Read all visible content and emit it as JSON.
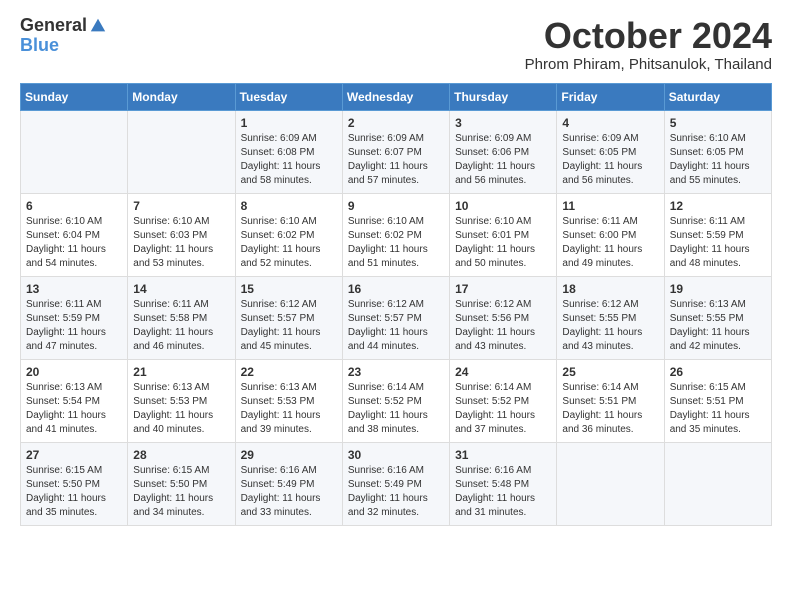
{
  "logo": {
    "general": "General",
    "blue": "Blue"
  },
  "title": "October 2024",
  "location": "Phrom Phiram, Phitsanulok, Thailand",
  "days_of_week": [
    "Sunday",
    "Monday",
    "Tuesday",
    "Wednesday",
    "Thursday",
    "Friday",
    "Saturday"
  ],
  "weeks": [
    [
      {
        "day": "",
        "info": ""
      },
      {
        "day": "",
        "info": ""
      },
      {
        "day": "1",
        "info": "Sunrise: 6:09 AM\nSunset: 6:08 PM\nDaylight: 11 hours and 58 minutes."
      },
      {
        "day": "2",
        "info": "Sunrise: 6:09 AM\nSunset: 6:07 PM\nDaylight: 11 hours and 57 minutes."
      },
      {
        "day": "3",
        "info": "Sunrise: 6:09 AM\nSunset: 6:06 PM\nDaylight: 11 hours and 56 minutes."
      },
      {
        "day": "4",
        "info": "Sunrise: 6:09 AM\nSunset: 6:05 PM\nDaylight: 11 hours and 56 minutes."
      },
      {
        "day": "5",
        "info": "Sunrise: 6:10 AM\nSunset: 6:05 PM\nDaylight: 11 hours and 55 minutes."
      }
    ],
    [
      {
        "day": "6",
        "info": "Sunrise: 6:10 AM\nSunset: 6:04 PM\nDaylight: 11 hours and 54 minutes."
      },
      {
        "day": "7",
        "info": "Sunrise: 6:10 AM\nSunset: 6:03 PM\nDaylight: 11 hours and 53 minutes."
      },
      {
        "day": "8",
        "info": "Sunrise: 6:10 AM\nSunset: 6:02 PM\nDaylight: 11 hours and 52 minutes."
      },
      {
        "day": "9",
        "info": "Sunrise: 6:10 AM\nSunset: 6:02 PM\nDaylight: 11 hours and 51 minutes."
      },
      {
        "day": "10",
        "info": "Sunrise: 6:10 AM\nSunset: 6:01 PM\nDaylight: 11 hours and 50 minutes."
      },
      {
        "day": "11",
        "info": "Sunrise: 6:11 AM\nSunset: 6:00 PM\nDaylight: 11 hours and 49 minutes."
      },
      {
        "day": "12",
        "info": "Sunrise: 6:11 AM\nSunset: 5:59 PM\nDaylight: 11 hours and 48 minutes."
      }
    ],
    [
      {
        "day": "13",
        "info": "Sunrise: 6:11 AM\nSunset: 5:59 PM\nDaylight: 11 hours and 47 minutes."
      },
      {
        "day": "14",
        "info": "Sunrise: 6:11 AM\nSunset: 5:58 PM\nDaylight: 11 hours and 46 minutes."
      },
      {
        "day": "15",
        "info": "Sunrise: 6:12 AM\nSunset: 5:57 PM\nDaylight: 11 hours and 45 minutes."
      },
      {
        "day": "16",
        "info": "Sunrise: 6:12 AM\nSunset: 5:57 PM\nDaylight: 11 hours and 44 minutes."
      },
      {
        "day": "17",
        "info": "Sunrise: 6:12 AM\nSunset: 5:56 PM\nDaylight: 11 hours and 43 minutes."
      },
      {
        "day": "18",
        "info": "Sunrise: 6:12 AM\nSunset: 5:55 PM\nDaylight: 11 hours and 43 minutes."
      },
      {
        "day": "19",
        "info": "Sunrise: 6:13 AM\nSunset: 5:55 PM\nDaylight: 11 hours and 42 minutes."
      }
    ],
    [
      {
        "day": "20",
        "info": "Sunrise: 6:13 AM\nSunset: 5:54 PM\nDaylight: 11 hours and 41 minutes."
      },
      {
        "day": "21",
        "info": "Sunrise: 6:13 AM\nSunset: 5:53 PM\nDaylight: 11 hours and 40 minutes."
      },
      {
        "day": "22",
        "info": "Sunrise: 6:13 AM\nSunset: 5:53 PM\nDaylight: 11 hours and 39 minutes."
      },
      {
        "day": "23",
        "info": "Sunrise: 6:14 AM\nSunset: 5:52 PM\nDaylight: 11 hours and 38 minutes."
      },
      {
        "day": "24",
        "info": "Sunrise: 6:14 AM\nSunset: 5:52 PM\nDaylight: 11 hours and 37 minutes."
      },
      {
        "day": "25",
        "info": "Sunrise: 6:14 AM\nSunset: 5:51 PM\nDaylight: 11 hours and 36 minutes."
      },
      {
        "day": "26",
        "info": "Sunrise: 6:15 AM\nSunset: 5:51 PM\nDaylight: 11 hours and 35 minutes."
      }
    ],
    [
      {
        "day": "27",
        "info": "Sunrise: 6:15 AM\nSunset: 5:50 PM\nDaylight: 11 hours and 35 minutes."
      },
      {
        "day": "28",
        "info": "Sunrise: 6:15 AM\nSunset: 5:50 PM\nDaylight: 11 hours and 34 minutes."
      },
      {
        "day": "29",
        "info": "Sunrise: 6:16 AM\nSunset: 5:49 PM\nDaylight: 11 hours and 33 minutes."
      },
      {
        "day": "30",
        "info": "Sunrise: 6:16 AM\nSunset: 5:49 PM\nDaylight: 11 hours and 32 minutes."
      },
      {
        "day": "31",
        "info": "Sunrise: 6:16 AM\nSunset: 5:48 PM\nDaylight: 11 hours and 31 minutes."
      },
      {
        "day": "",
        "info": ""
      },
      {
        "day": "",
        "info": ""
      }
    ]
  ]
}
